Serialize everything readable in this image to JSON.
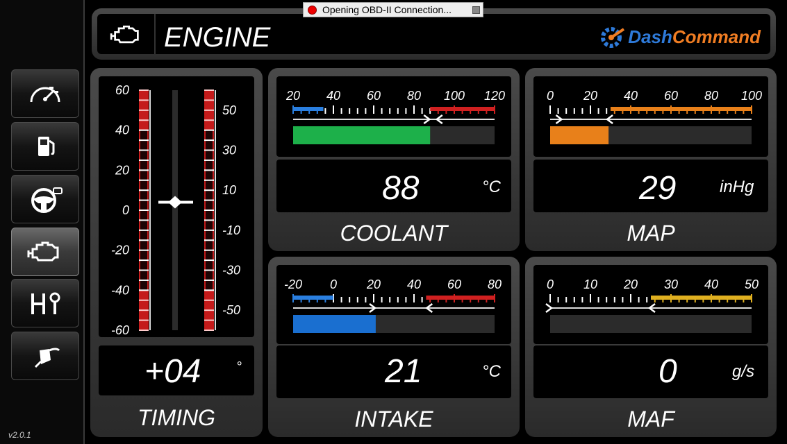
{
  "app": {
    "brand_part1": "Dash",
    "brand_part2": "Command",
    "version": "v2.0.1",
    "status_toast": "Opening OBD-II Connection..."
  },
  "header": {
    "title": "ENGINE",
    "icon": "engine-icon"
  },
  "sidebar": {
    "items": [
      {
        "icon": "speedometer-icon",
        "active": false
      },
      {
        "icon": "fuel-pump-icon",
        "active": false
      },
      {
        "icon": "steering-wheel-icon",
        "active": false
      },
      {
        "icon": "engine-icon",
        "active": true
      },
      {
        "icon": "gear-shifter-icon",
        "active": false
      },
      {
        "icon": "fuel-nozzle-icon",
        "active": false
      }
    ]
  },
  "colors": {
    "accent_blue": "#2e7ad9",
    "accent_orange": "#f07d23",
    "red": "#cc1f1f",
    "green": "#1db04a",
    "orange_bar": "#e8801a",
    "blue_bar": "#1a6fd0"
  },
  "gauges": {
    "timing": {
      "label": "TIMING",
      "value": "+04",
      "unit": "°",
      "left_ticks": [
        "60",
        "40",
        "20",
        "0",
        "-20",
        "-40",
        "-60"
      ],
      "right_ticks": [
        "50",
        "30",
        "10",
        "-10",
        "-30",
        "-50"
      ],
      "reading": 4
    },
    "coolant": {
      "label": "COOLANT",
      "value": "88",
      "unit": "°C",
      "ticks": [
        "20",
        "40",
        "60",
        "80",
        "100",
        "120"
      ],
      "min": 20,
      "max": 120,
      "reading": 88,
      "marker_low": 87,
      "marker_high": 92,
      "bar_color": "green"
    },
    "map": {
      "label": "MAP",
      "value": "29",
      "unit": "inHg",
      "ticks": [
        "0",
        "20",
        "40",
        "60",
        "80",
        "100"
      ],
      "min": 0,
      "max": 100,
      "reading": 29,
      "marker_low": 5,
      "marker_high": 29,
      "bar_color": "orange"
    },
    "intake": {
      "label": "INTAKE",
      "value": "21",
      "unit": "°C",
      "ticks": [
        "-20",
        "0",
        "20",
        "40",
        "60",
        "80"
      ],
      "min": -20,
      "max": 80,
      "reading": 21,
      "marker_low": 20,
      "marker_high": 47,
      "bar_color": "blue"
    },
    "maf": {
      "label": "MAF",
      "value": "0",
      "unit": "g/s",
      "ticks": [
        "0",
        "10",
        "20",
        "30",
        "40",
        "50"
      ],
      "min": 0,
      "max": 50,
      "reading": 0,
      "marker_low": 0,
      "marker_high": 25,
      "bar_color": "none"
    }
  }
}
